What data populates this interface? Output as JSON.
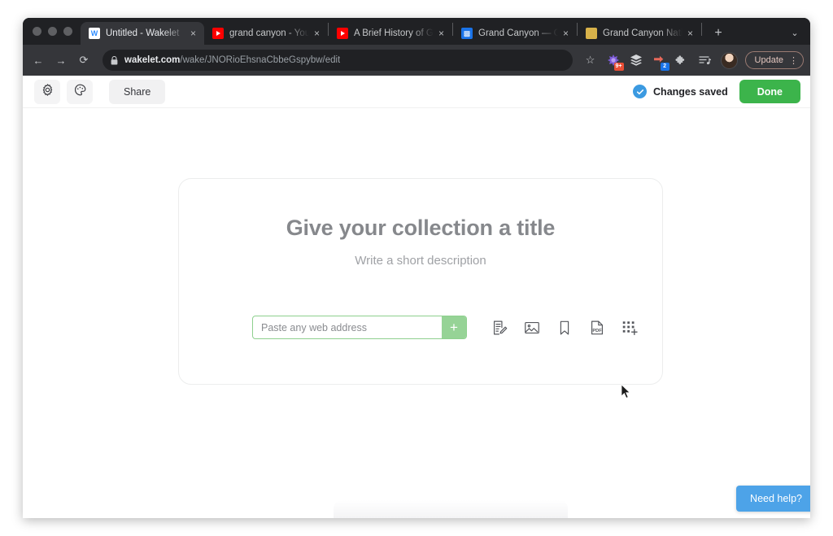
{
  "browser": {
    "tabs": [
      {
        "title": "Untitled - Wakelet",
        "favicon": "wakelet-icon",
        "active": true,
        "close_label": "×"
      },
      {
        "title": "grand canyon - YouTube",
        "favicon": "youtube-icon",
        "active": false,
        "close_label": "×"
      },
      {
        "title": "A Brief History of Grand Ca",
        "favicon": "youtube-icon",
        "active": false,
        "close_label": "×"
      },
      {
        "title": "Grand Canyon — Google A",
        "favicon": "google-arts-icon",
        "active": false,
        "close_label": "×"
      },
      {
        "title": "Grand Canyon National Pa",
        "favicon": "nps-icon",
        "active": false,
        "close_label": "×"
      }
    ],
    "new_tab_label": "+",
    "tab_list_label": "⌄",
    "nav": {
      "back": "←",
      "forward": "→",
      "reload": "⟳"
    },
    "omnibox": {
      "lock_icon": "lock-icon",
      "url_domain": "wakelet.com",
      "url_path": "/wake/JNORioEhsnaCbbeGspybw/edit",
      "star_icon": "star-icon"
    },
    "extensions": [
      {
        "name": "extension-puzzle-burst-icon",
        "badge": "9+",
        "badge_color": "#ea4e35"
      },
      {
        "name": "layers-stack-icon",
        "badge": "",
        "badge_color": ""
      },
      {
        "name": "pocket-save-icon",
        "badge": "2",
        "badge_color": "#1a73e8"
      },
      {
        "name": "extensions-puzzle-icon",
        "badge": "",
        "badge_color": ""
      },
      {
        "name": "reading-list-icon",
        "badge": "",
        "badge_color": ""
      }
    ],
    "avatar_label": "profile-avatar",
    "update_label": "Update",
    "kebab_label": "⋮"
  },
  "app_header": {
    "settings_icon": "gear-icon",
    "theme_icon": "palette-icon",
    "share_label": "Share",
    "status_label": "Changes saved",
    "status_color": "#3b9ae1",
    "done_label": "Done",
    "done_color": "#3cb44b"
  },
  "card": {
    "title_placeholder": "Give your collection a title",
    "description_placeholder": "Write a short description",
    "url_input": {
      "value": "",
      "placeholder": "Paste any web address",
      "accent_color": "#8ed08e",
      "add_label": "+"
    },
    "tools": [
      {
        "name": "text-note-icon",
        "label": "Text"
      },
      {
        "name": "image-icon",
        "label": "Image"
      },
      {
        "name": "bookmark-icon",
        "label": "Bookmark"
      },
      {
        "name": "pdf-icon",
        "label": "PDF"
      },
      {
        "name": "grid-add-icon",
        "label": "More"
      }
    ]
  },
  "support": {
    "need_help_label": "Need help?",
    "need_help_color": "#4da3e8"
  }
}
